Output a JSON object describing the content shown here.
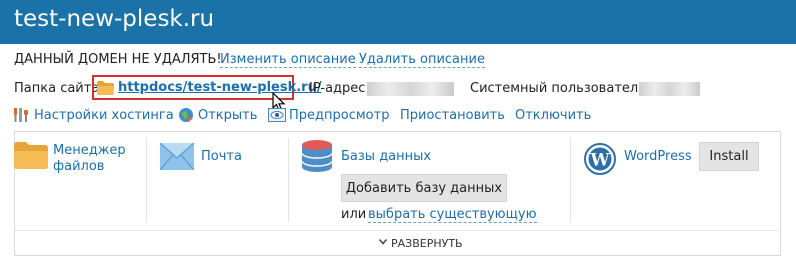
{
  "header": {
    "domain": "test-new-plesk.ru"
  },
  "description": {
    "text": "ДАННЫЙ ДОМЕН НЕ УДАЛЯТЬ!",
    "edit_link": "Изменить описание",
    "delete_link": "Удалить описание"
  },
  "info": {
    "folder_label": "Папка сайта",
    "folder_path": "httpdocs/test-new-plesk.ru/",
    "ip_label": "IP-адрес:",
    "user_label": "Системный пользователь:"
  },
  "actions": [
    "Настройки хостинга",
    "Открыть",
    "Предпросмотр",
    "Приостановить",
    "Отключить"
  ],
  "tools": {
    "file_manager": "Менеджер файлов",
    "mail": "Почта",
    "databases": "Базы данных",
    "add_db_button": "Добавить базу данных",
    "or_text": "или",
    "choose_existing": "выбрать существующую",
    "wordpress": "WordPress",
    "install_button": "Install"
  },
  "expand_label": "РАЗВЕРНУТЬ",
  "colors": {
    "header_bg": "#1a72a8",
    "link": "#1a6fb0",
    "highlight_border": "#d3302e"
  }
}
